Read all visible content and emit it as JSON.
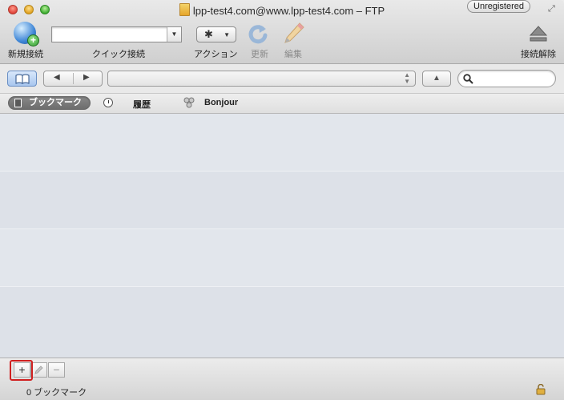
{
  "window": {
    "title": "lpp-test4.com@www.lpp-test4.com – FTP",
    "badge": "Unregistered"
  },
  "toolbar": {
    "new_connection_label": "新規接続",
    "quick_connect_label": "クイック接続",
    "quick_connect_value": "",
    "action_label": "アクション",
    "refresh_label": "更新",
    "edit_label": "編集",
    "disconnect_label": "接続解除"
  },
  "pathbar": {
    "path_value": "",
    "search_value": ""
  },
  "tabs": {
    "bookmarks": "ブックマーク",
    "history": "履歴",
    "bonjour": "Bonjour"
  },
  "bottom": {
    "add_button": "+",
    "remove_button": "−",
    "status": "0 ブックマーク"
  },
  "colors": {
    "selected_tab": "#7a7a7a",
    "highlight_border": "#d02020",
    "list_background": "#e2e6ec"
  }
}
